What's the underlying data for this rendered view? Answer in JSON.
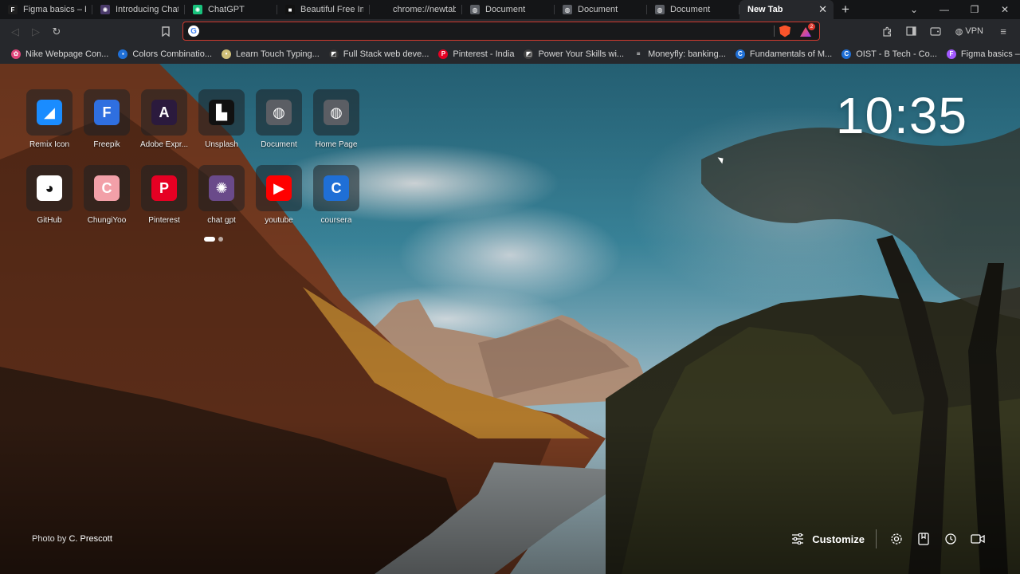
{
  "tabs": [
    {
      "title": "Figma basics – Figma",
      "fav_color": "#1e1e1e",
      "fav_glyph": "F"
    },
    {
      "title": "Introducing ChatGPT",
      "fav_color": "#4a3a6a",
      "fav_glyph": "✺"
    },
    {
      "title": "ChatGPT",
      "fav_color": "#19c37d",
      "fav_glyph": "✺"
    },
    {
      "title": "Beautiful Free Images",
      "fav_color": "#111111",
      "fav_glyph": "■"
    },
    {
      "title": "chrome://newtab",
      "fav_color": "#141517",
      "fav_glyph": ""
    },
    {
      "title": "Document",
      "fav_color": "#5b5e64",
      "fav_glyph": "◍"
    },
    {
      "title": "Document",
      "fav_color": "#5b5e64",
      "fav_glyph": "◍"
    },
    {
      "title": "Document",
      "fav_color": "#5b5e64",
      "fav_glyph": "◍"
    },
    {
      "title": "New Tab",
      "fav_color": "",
      "fav_glyph": "",
      "active": true
    }
  ],
  "omnibox": {
    "value": "",
    "placeholder": ""
  },
  "toolbar": {
    "vpn_label": "VPN",
    "rewards_badge": "2"
  },
  "bookmarks": [
    {
      "title": "Nike Webpage Con...",
      "color": "#e0457a",
      "glyph": "✿"
    },
    {
      "title": "Colors Combinatio...",
      "color": "#1f6fd6",
      "glyph": "▪"
    },
    {
      "title": "Learn Touch Typing...",
      "color": "#d0c07a",
      "glyph": "•"
    },
    {
      "title": "Full Stack web deve...",
      "color": "#333333",
      "glyph": "◩"
    },
    {
      "title": "Pinterest - India",
      "color": "#e60023",
      "glyph": "P"
    },
    {
      "title": "Power Your Skills wi...",
      "color": "#444444",
      "glyph": "◩"
    },
    {
      "title": "Moneyfly: banking...",
      "color": "#26282c",
      "glyph": "≡"
    },
    {
      "title": "Fundamentals of M...",
      "color": "#1f6fd6",
      "glyph": "C"
    },
    {
      "title": "OIST - B Tech - Co...",
      "color": "#1f6fd6",
      "glyph": "C"
    },
    {
      "title": "Figma basics – Figma",
      "color": "#a259ff",
      "glyph": "F"
    }
  ],
  "shortcuts": [
    {
      "label": "Remix Icon",
      "bg": "#1a8cff",
      "glyph": "◢"
    },
    {
      "label": "Freepik",
      "bg": "#2f6fe0",
      "glyph": "F"
    },
    {
      "label": "Adobe Expr...",
      "bg": "#2b1a3d",
      "glyph": "A"
    },
    {
      "label": "Unsplash",
      "bg": "#111111",
      "glyph": "▙"
    },
    {
      "label": "Document",
      "bg": "#5b5e64",
      "glyph": "◍"
    },
    {
      "label": "Home Page",
      "bg": "#5b5e64",
      "glyph": "◍"
    },
    {
      "label": "GitHub",
      "bg": "#ffffff",
      "glyph": "◕"
    },
    {
      "label": "ChungiYoo",
      "bg": "#f2a0a8",
      "glyph": "C"
    },
    {
      "label": "Pinterest",
      "bg": "#e60023",
      "glyph": "P"
    },
    {
      "label": "chat gpt",
      "bg": "#6a4a8a",
      "glyph": "✺"
    },
    {
      "label": "youtube",
      "bg": "#ff0000",
      "glyph": "▶"
    },
    {
      "label": "coursera",
      "bg": "#1f6fd6",
      "glyph": "C"
    }
  ],
  "clock": "10:35",
  "photo_credit": {
    "prefix": "Photo by",
    "author": "C. Prescott"
  },
  "customize_label": "Customize"
}
